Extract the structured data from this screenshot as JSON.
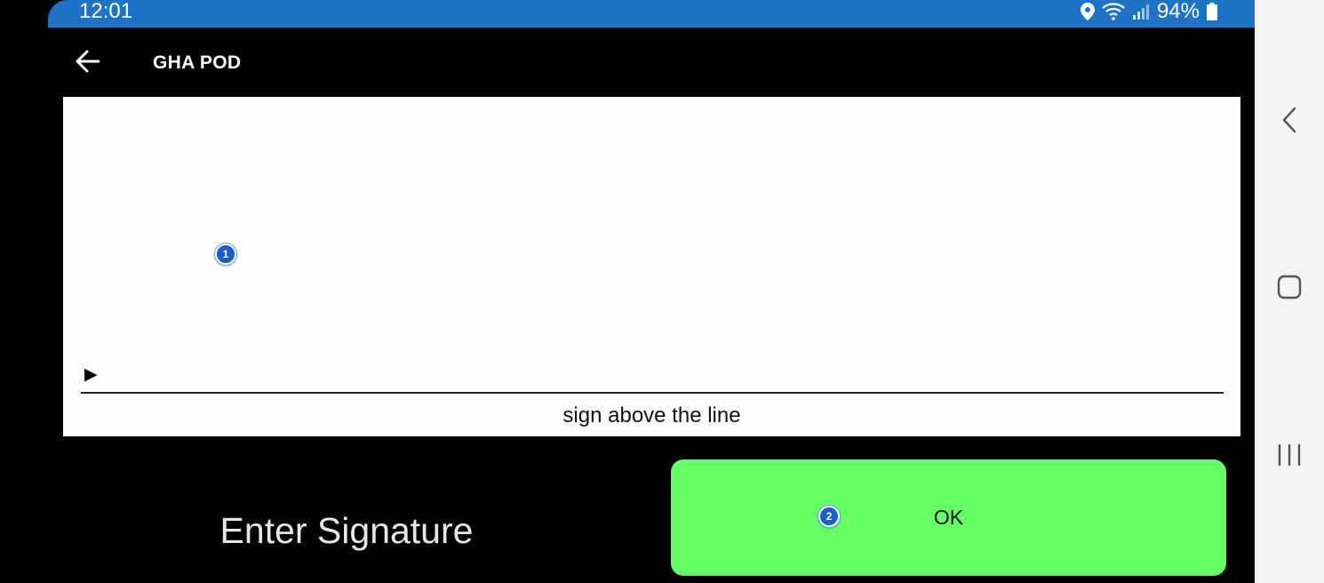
{
  "status_bar": {
    "time": "12:01",
    "battery": "94%",
    "icons": [
      "location-icon",
      "wifi-icon",
      "signal-icon",
      "battery-icon"
    ]
  },
  "app_bar": {
    "title": "GHA POD",
    "back_icon": "arrow-left-icon"
  },
  "signature_pad": {
    "marker": "▶",
    "hint": "sign above the line"
  },
  "footer": {
    "prompt": "Enter Signature",
    "ok_label": "OK"
  },
  "annotations": [
    "1",
    "2"
  ],
  "nav_bar": {
    "icons": [
      "back-chevron-icon",
      "home-icon",
      "recents-icon"
    ]
  },
  "colors": {
    "status_bar": "#1f73c7",
    "ok_button": "#66ff66",
    "background": "#000000",
    "marker": "#1a5fc8"
  }
}
